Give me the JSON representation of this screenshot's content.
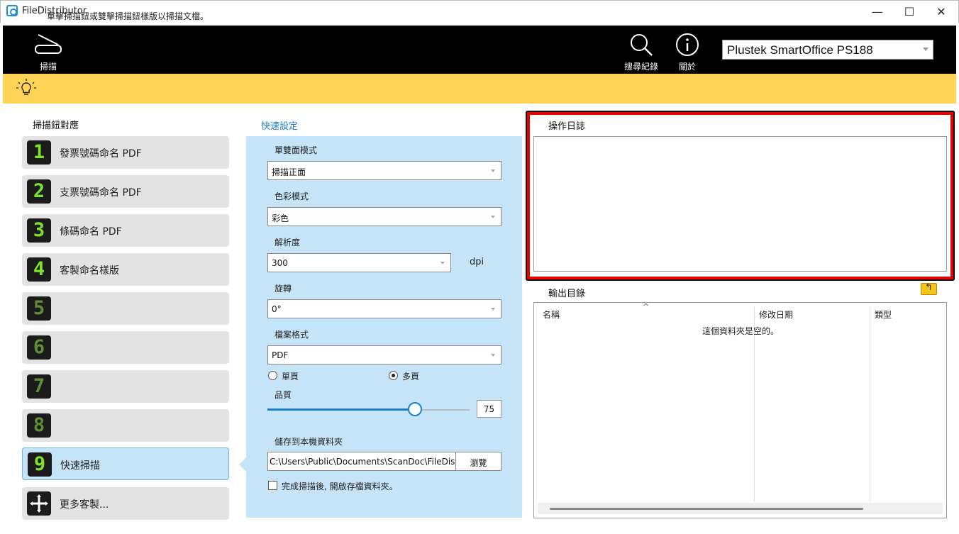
{
  "window": {
    "title": "FileDistributor",
    "controls": {
      "minimize": "—",
      "maximize": "☐",
      "close": "✕"
    }
  },
  "toolbar": {
    "scan_label": "掃描",
    "search_log_label": "搜尋紀錄",
    "about_label": "關於",
    "device": "Plustek SmartOffice PS188"
  },
  "hint": {
    "text": "單擊掃描鈕或雙擊掃描鈕樣版以掃描文檔。"
  },
  "left_panel": {
    "title": "掃描鈕對應",
    "slots": [
      {
        "number": "1",
        "label": "發票號碼命名 PDF"
      },
      {
        "number": "2",
        "label": "支票號碼命名 PDF"
      },
      {
        "number": "3",
        "label": "條碼命名 PDF"
      },
      {
        "number": "4",
        "label": "客製命名樣版"
      },
      {
        "number": "5",
        "label": ""
      },
      {
        "number": "6",
        "label": ""
      },
      {
        "number": "7",
        "label": ""
      },
      {
        "number": "8",
        "label": ""
      },
      {
        "number": "9",
        "label": "快速掃描"
      }
    ],
    "more": {
      "label": "更多客製..."
    }
  },
  "quick_settings": {
    "title": "快速設定",
    "duplex": {
      "label": "單雙面模式",
      "value": "掃描正面"
    },
    "color": {
      "label": "色彩模式",
      "value": "彩色"
    },
    "resolution": {
      "label": "解析度",
      "value": "300",
      "unit": "dpi"
    },
    "rotation": {
      "label": "旋轉",
      "value": "0°"
    },
    "format": {
      "label": "檔案格式",
      "value": "PDF"
    },
    "page_mode": {
      "single": "單頁",
      "multi": "多頁",
      "selected": "multi"
    },
    "quality": {
      "label": "品質",
      "value": "75",
      "fraction": 0.73
    },
    "save_folder": {
      "label": "儲存到本機資料夾",
      "path": "C:\\Users\\Public\\Documents\\ScanDoc\\FileDistri",
      "browse": "瀏覽"
    },
    "open_after": {
      "label": "完成掃描後, 開啟存檔資料夾。",
      "checked": false
    }
  },
  "log": {
    "title": "操作日誌"
  },
  "output": {
    "title": "輸出目錄",
    "columns": {
      "name": "名稱",
      "modified": "修改日期",
      "type": "類型"
    },
    "empty_message": "這個資料夾是空的。"
  }
}
